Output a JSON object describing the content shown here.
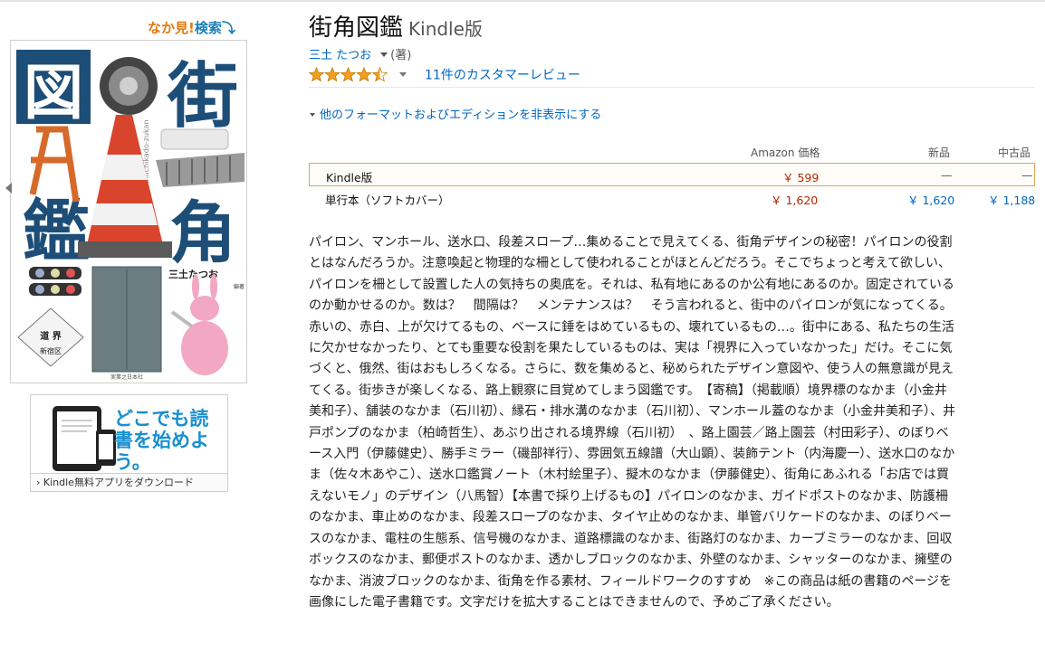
{
  "look_inside": {
    "part1": "なか見!",
    "part2": "検索",
    "arrow": "⤵"
  },
  "cover": {
    "title_chars": [
      "図",
      "街",
      "鑑",
      "角"
    ],
    "spine_text": "machikado-zukan",
    "author": "三土たつお",
    "role": "編著",
    "sign_main": "道 界",
    "sign_sub": "新宿区",
    "publisher": "実業之日本社",
    "colors": {
      "navy": "#1d4e78",
      "cone_red": "#d8442c",
      "cone_white": "#f2f2f2"
    }
  },
  "kindle_ad": {
    "headline": "どこでも読書を始めよう。",
    "cta": "Kindle無料アプリをダウンロード",
    "chevron": "›"
  },
  "product": {
    "title": "街角図鑑",
    "format": "Kindle版",
    "author": "三土 たつお",
    "role": "(著)",
    "rating_value": 4.5,
    "rating_max": 5,
    "reviews_link": "11件のカスタマーレビュー",
    "formats_toggle": "他のフォーマットおよびエディションを非表示にする"
  },
  "formats": {
    "headers": {
      "amazon": "Amazon 価格",
      "new": "新品",
      "used": "中古品"
    },
    "rows": [
      {
        "name": "Kindle版",
        "amazon": "￥ 599",
        "new": "—",
        "used": "—"
      },
      {
        "name": "単行本（ソフトカバー）",
        "amazon": "￥ 1,620",
        "new": "￥ 1,620",
        "used": "￥ 1,188"
      }
    ]
  },
  "description": "パイロン、マンホール、送水口、段差スロープ…集めることで見えてくる、街角デザインの秘密！パイロンの役割とはなんだろうか。注意喚起と物理的な柵として使われることがほとんどだろう。そこでちょっと考えて欲しい、パイロンを柵として設置した人の気持ちの奥底を。それは、私有地にあるのか公有地にあるのか。固定されているのか動かせるのか。数は？　間隔は？　メンテナンスは？　そう言われると、街中のパイロンが気になってくる。赤いの、赤白、上が欠けてるもの、ベースに錘をはめているもの、壊れているもの…。街中にある、私たちの生活に欠かせなかったり、とても重要な役割を果たしているものは、実は「視界に入っていなかった」だけ。そこに気づくと、俄然、街はおもしろくなる。さらに、数を集めると、秘められたデザイン意図や、使う人の無意識が見えてくる。街歩きが楽しくなる、路上観察に目覚めてしまう図鑑です。　【寄稿】（掲載順）境界標のなかま（小金井美和子）、舗装のなかま（石川初）、縁石・排水溝のなかま（石川初）、マンホール蓋のなかま（小金井美和子）、井戸ポンプのなかま（柏崎哲生）、あぶり出される境界線（石川初）　、路上園芸／路上園芸（村田彩子）、のぼりベース入門（伊藤健史）、勝手ミラー（磯部祥行）、雰囲気五線譜（大山顕）、装飾テント（内海慶一）、送水口のなかま（佐々木あやこ）、送水口鑑賞ノート（木村絵里子）、擬木のなかま（伊藤健史）、街角にあふれる「お店では買えないモノ」のデザイン（八馬智）【本書で採り上げるもの】パイロンのなかま、ガイドポストのなかま、防護柵のなかま、車止めのなかま、段差スロープのなかま、タイヤ止めのなかま、単管バリケードのなかま、のぼりベースのなかま、電柱の生態系、信号機のなかま、道路標識のなかま、街路灯のなかま、カーブミラーのなかま、回収ボックスのなかま、郵便ポストのなかま、透かしブロックのなかま、外壁のなかま、シャッターのなかま、擁壁のなかま、消波ブロックのなかま、街角を作る素材、フィールドワークのすすめ　※この商品は紙の書籍のページを画像にした電子書籍です。文字だけを拡大することはできませんので、予めご了承ください。",
  "colors": {
    "link": "#0066c0",
    "price": "#b12704",
    "star": "#f0a01e",
    "selected_border": "#e0a35b"
  }
}
